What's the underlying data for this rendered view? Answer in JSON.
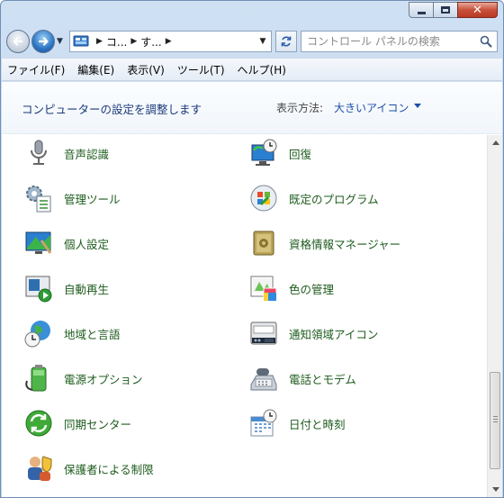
{
  "window": {
    "caption_min": "minimize",
    "caption_max": "maximize",
    "caption_close": "✕"
  },
  "navbar": {
    "breadcrumbs": [
      "コ...",
      "す..."
    ],
    "search_placeholder": "コントロール パネルの検索"
  },
  "menu": [
    "ファイル(F)",
    "編集(E)",
    "表示(V)",
    "ツール(T)",
    "ヘルプ(H)"
  ],
  "header": {
    "title": "コンピューターの設定を調整します",
    "view_by_label": "表示方法:",
    "view_by_value": "大きいアイコン"
  },
  "items_left": [
    {
      "label": "音声認識",
      "icon": "microphone-icon"
    },
    {
      "label": "管理ツール",
      "icon": "admin-tools-icon"
    },
    {
      "label": "個人設定",
      "icon": "personalization-icon"
    },
    {
      "label": "自動再生",
      "icon": "autoplay-icon"
    },
    {
      "label": "地域と言語",
      "icon": "globe-clock-icon"
    },
    {
      "label": "電源オプション",
      "icon": "battery-icon"
    },
    {
      "label": "同期センター",
      "icon": "sync-icon"
    },
    {
      "label": "保護者による制限",
      "icon": "parental-controls-icon"
    }
  ],
  "items_right": [
    {
      "label": "回復",
      "icon": "recovery-icon"
    },
    {
      "label": "既定のプログラム",
      "icon": "default-programs-icon"
    },
    {
      "label": "資格情報マネージャー",
      "icon": "vault-icon"
    },
    {
      "label": "色の管理",
      "icon": "color-management-icon"
    },
    {
      "label": "通知領域アイコン",
      "icon": "notification-area-icon"
    },
    {
      "label": "電話とモデム",
      "icon": "phone-modem-icon"
    },
    {
      "label": "日付と時刻",
      "icon": "calendar-clock-icon"
    }
  ],
  "colors": {
    "link_green": "#1d5b1d",
    "heading_blue": "#1c3a7a",
    "accent_blue": "#1d4fa8"
  }
}
